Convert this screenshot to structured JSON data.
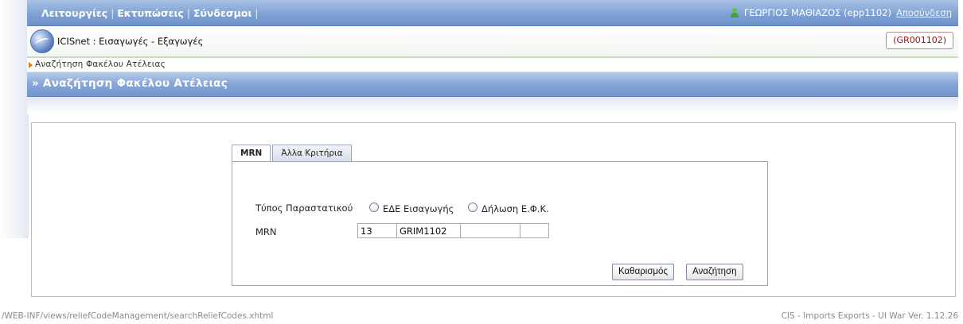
{
  "menu": {
    "items": [
      "Λειτουργίες",
      "Εκτυπώσεις",
      "Σύνδεσμοι"
    ],
    "separator": "|"
  },
  "user": {
    "name": "ΓΕΩΡΓΙΟΣ ΜΑΘΙΑΖΟΣ (epp1102)",
    "logout_label": "Αποσύνδεση",
    "icon": "user-icon"
  },
  "app": {
    "title": "ICISnet : Εισαγωγές - Εξαγωγές",
    "office_code": "(GR001102)",
    "logo_icon": "icisnet-logo-icon"
  },
  "breadcrumb": "Αναζήτηση Φακέλου Ατέλειας",
  "page_title": "» Αναζήτηση Φακέλου Ατέλειας",
  "tabs": [
    {
      "label": "MRN",
      "active": true
    },
    {
      "label": "Άλλα Κριτήρια",
      "active": false
    }
  ],
  "form": {
    "doc_type_label": "Τύπος Παραστατικού",
    "radio_options": [
      "ΕΔΕ Εισαγωγής",
      "Δήλωση Ε.Φ.Κ."
    ],
    "mrn_label": "MRN",
    "mrn_fields": [
      "13",
      "GRIM1102",
      "",
      ""
    ]
  },
  "buttons": {
    "clear": "Καθαρισμός",
    "search": "Αναζήτηση"
  },
  "footer": {
    "path": "/WEB-INF/views/reliefCodeManagement/searchReliefCodes.xhtml",
    "version": "CIS - Imports Exports - UI War Ver. 1.12.26"
  },
  "colors": {
    "menu_bar": "#7fa1d4",
    "title_bar": "#86a6d8",
    "office_code_text": "#8b1414",
    "breadcrumb_arrow": "#e07a1a"
  }
}
